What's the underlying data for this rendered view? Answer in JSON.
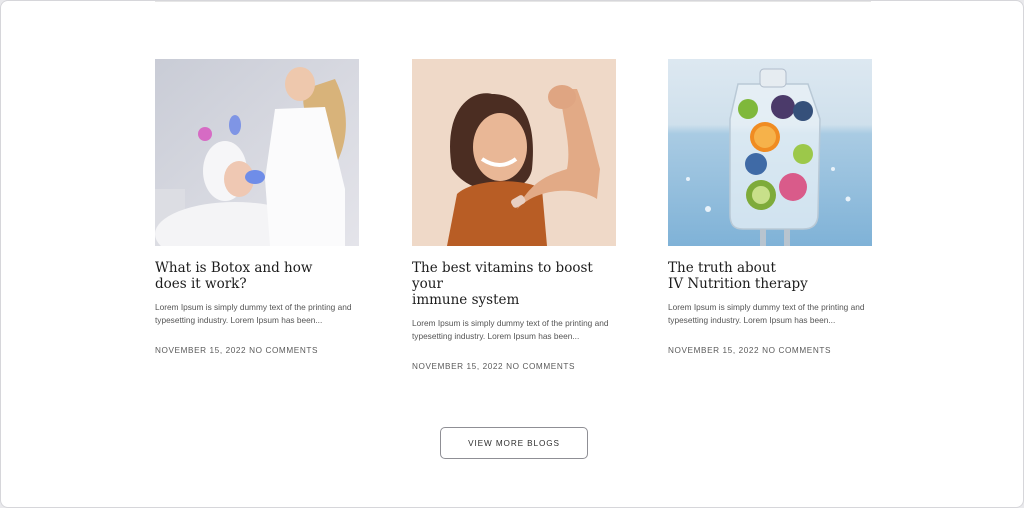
{
  "posts": [
    {
      "title": "What is Botox and how\ndoes it work?",
      "excerpt": "Lorem Ipsum is simply dummy text of the printing and\ntypesetting industry. Lorem Ipsum has been...",
      "date": "NOVEMBER 15, 2022",
      "comments": "NO COMMENTS",
      "image": "woman-receiving-botox-injection-photo"
    },
    {
      "title": "The best vitamins to boost your\nimmune system",
      "excerpt": "Lorem Ipsum is simply dummy text of the printing and\ntypesetting industry. Lorem Ipsum has been...",
      "date": "NOVEMBER 15, 2022",
      "comments": "NO COMMENTS",
      "image": "woman-flexing-arm-with-bandage-photo"
    },
    {
      "title": "The truth about\nIV Nutrition therapy",
      "excerpt": "Lorem Ipsum is simply dummy text of the printing and\ntypesetting industry. Lorem Ipsum has been...",
      "date": "NOVEMBER 15, 2022",
      "comments": "NO COMMENTS",
      "image": "iv-bag-with-fruit-photo"
    }
  ],
  "view_more_label": "VIEW MORE BLOGS"
}
